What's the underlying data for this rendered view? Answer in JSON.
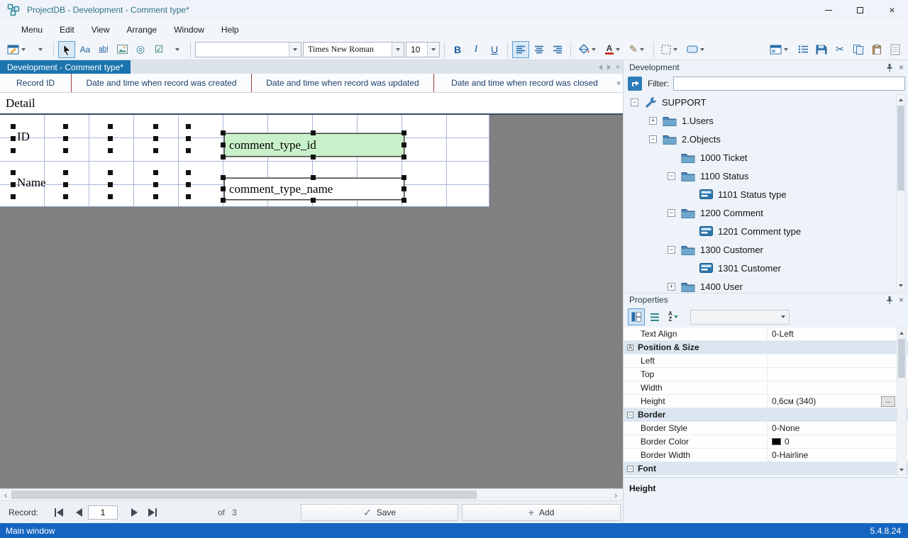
{
  "icons": {
    "close": "×",
    "check": "✓",
    "plus": "+",
    "scissors": "✂",
    "pencil": "✎",
    "ellipse": "◎",
    "checkbox": "☑",
    "chevron_left": "‹",
    "chevron_right": "›",
    "double_chevron": "»",
    "ellipsis": "...",
    "sort_a": "A",
    "sort_z": "Z"
  },
  "titlebar": {
    "title": "ProjectDB - Development - Comment type*"
  },
  "menubar": {
    "items": [
      "Menu",
      "Edit",
      "View",
      "Arrange",
      "Window",
      "Help"
    ]
  },
  "toolbar": {
    "label_tool": "Aa",
    "textbox_tool": "ab|",
    "font_name_value": "",
    "font_family_value": "Times New Roman",
    "font_size_value": "10",
    "bold": "B",
    "italic": "I",
    "underline": "U",
    "font_color_letter": "A"
  },
  "tabs": {
    "active": "Development - Comment type*"
  },
  "grid_header": {
    "columns": [
      "Record ID",
      "Date and time when record was created",
      "Date and time when record was updated",
      "Date and time when record was closed"
    ]
  },
  "designer": {
    "band": "Detail",
    "label_id": "ID",
    "label_name": "Name",
    "field_id": "comment_type_id",
    "field_name": "comment_type_name"
  },
  "development": {
    "title": "Development",
    "filter_label": "Filter:",
    "filter_value": "",
    "tree": [
      {
        "label": "SUPPORT",
        "expander": "−"
      },
      {
        "label": "1.Users",
        "expander": "+"
      },
      {
        "label": "2.Objects",
        "expander": "−"
      },
      {
        "label": "1000 Ticket",
        "expander": ""
      },
      {
        "label": "1100 Status",
        "expander": "−"
      },
      {
        "label": "1101 Status type",
        "expander": ""
      },
      {
        "label": "1200 Comment",
        "expander": "−"
      },
      {
        "label": "1201 Comment type",
        "expander": ""
      },
      {
        "label": "1300 Customer",
        "expander": "−"
      },
      {
        "label": "1301 Customer",
        "expander": ""
      },
      {
        "label": "1400 User",
        "expander": "+"
      }
    ]
  },
  "properties": {
    "title": "Properties",
    "combo_value": "",
    "rows": [
      {
        "label": "Text Align",
        "value": "0-Left"
      },
      {
        "label": "Position & Size",
        "value": ""
      },
      {
        "label": "Left",
        "value": ""
      },
      {
        "label": "Top",
        "value": ""
      },
      {
        "label": "Width",
        "value": ""
      },
      {
        "label": "Height",
        "value": "0,6см (340)"
      },
      {
        "label": "Border",
        "value": ""
      },
      {
        "label": "Border Style",
        "value": "0-None"
      },
      {
        "label": "Border Color",
        "value": "0",
        "swatch_style": "background:#000000"
      },
      {
        "label": "Border Width",
        "value": "0-Hairline"
      },
      {
        "label": "Font",
        "value": ""
      }
    ],
    "description_title": "Height"
  },
  "record_bar": {
    "label": "Record:",
    "current": "1",
    "of_label": "of",
    "total": "3",
    "save": "Save",
    "add": "Add"
  },
  "statusbar": {
    "left": "Main window",
    "right": "5.4.8.24"
  }
}
